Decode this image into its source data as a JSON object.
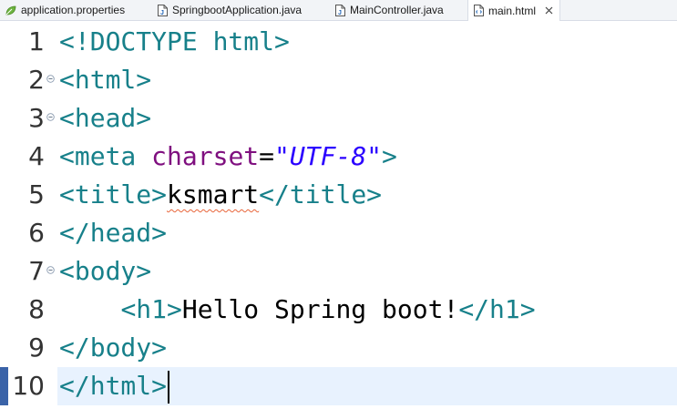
{
  "tabs": [
    {
      "label": "application.properties",
      "icon": "spring-leaf-icon",
      "active": false
    },
    {
      "label": "SpringbootApplication.java",
      "icon": "java-file-icon",
      "active": false
    },
    {
      "label": "MainController.java",
      "icon": "java-file-icon",
      "active": false
    },
    {
      "label": "main.html",
      "icon": "html-file-icon",
      "active": true
    }
  ],
  "editor": {
    "current_line": 10,
    "lines": [
      {
        "number": "1",
        "tokens": [
          {
            "t": "tag",
            "v": "<!DOCTYPE html>"
          }
        ]
      },
      {
        "number": "2",
        "fold": true,
        "tokens": [
          {
            "t": "tag",
            "v": "<html>"
          }
        ]
      },
      {
        "number": "3",
        "fold": true,
        "tokens": [
          {
            "t": "tag",
            "v": "<head>"
          }
        ]
      },
      {
        "number": "4",
        "tokens": [
          {
            "t": "tag",
            "v": "<meta "
          },
          {
            "t": "attr",
            "v": "charset"
          },
          {
            "t": "txt",
            "v": "="
          },
          {
            "t": "str",
            "v": "\"UTF-8\""
          },
          {
            "t": "tag",
            "v": ">"
          }
        ]
      },
      {
        "number": "5",
        "tokens": [
          {
            "t": "tag",
            "v": "<title>"
          },
          {
            "t": "txt",
            "v": "ksmart",
            "spell": true
          },
          {
            "t": "tag",
            "v": "</title>"
          }
        ]
      },
      {
        "number": "6",
        "tokens": [
          {
            "t": "tag",
            "v": "</head>"
          }
        ]
      },
      {
        "number": "7",
        "fold": true,
        "tokens": [
          {
            "t": "tag",
            "v": "<body>"
          }
        ]
      },
      {
        "number": "8",
        "tokens": [
          {
            "t": "txt",
            "v": "    "
          },
          {
            "t": "tag",
            "v": "<h1>"
          },
          {
            "t": "txt",
            "v": "Hello Spring boot!"
          },
          {
            "t": "tag",
            "v": "</h1>"
          }
        ]
      },
      {
        "number": "9",
        "tokens": [
          {
            "t": "tag",
            "v": "</body>"
          }
        ]
      },
      {
        "number": "10",
        "caret": true,
        "tokens": [
          {
            "t": "tag",
            "v": "</html>"
          }
        ]
      }
    ]
  },
  "colors": {
    "tag": "#17808a",
    "attribute": "#7f0f7f",
    "string": "#2a00ff",
    "current_line_bg": "#e8f2fe",
    "gutter_marker": "#3a63a8",
    "spell_underline": "#e8653a"
  }
}
